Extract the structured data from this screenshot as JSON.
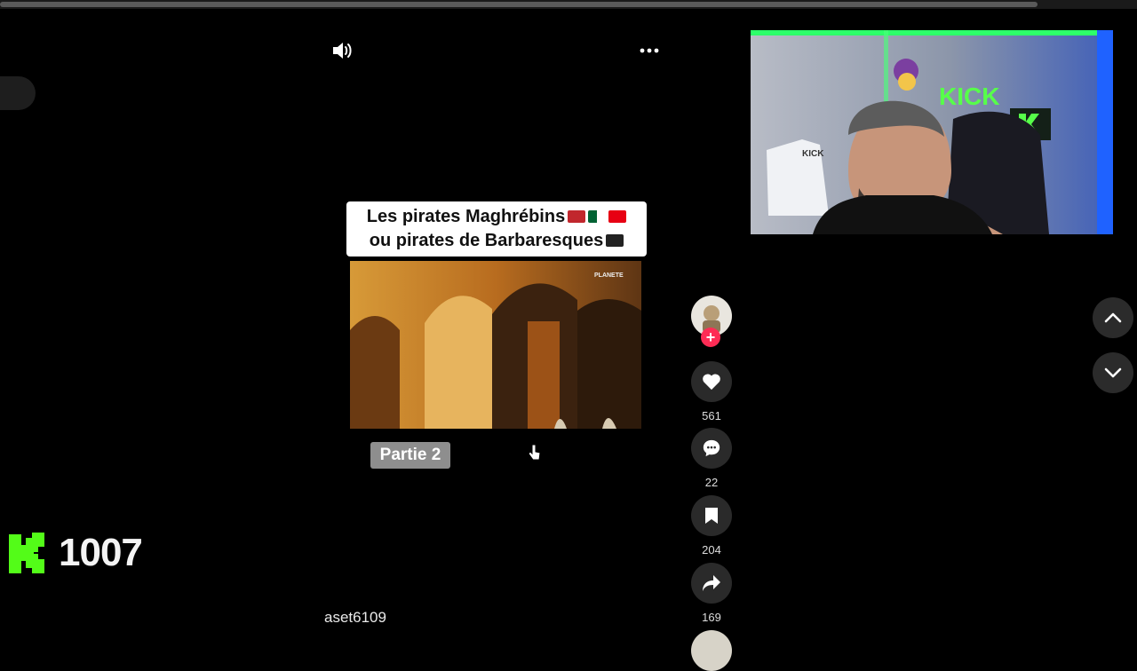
{
  "player": {
    "caption_line1": "Les pirates Maghrébins",
    "caption_line2": "ou pirates de Barbaresques",
    "channel_watermark": "PLANETE",
    "part_label": "Partie 2",
    "username": "aset6109"
  },
  "actions": {
    "likes": "561",
    "comments": "22",
    "saves": "204",
    "shares": "169"
  },
  "overlay": {
    "kick_count": "1007",
    "kick_brand": "KICK",
    "accent": "#53fc18"
  },
  "icons": [
    "volume-icon",
    "more-icon",
    "heart-icon",
    "comment-icon",
    "bookmark-icon",
    "share-icon",
    "chevron-up-icon",
    "chevron-down-icon",
    "cursor-icon"
  ]
}
